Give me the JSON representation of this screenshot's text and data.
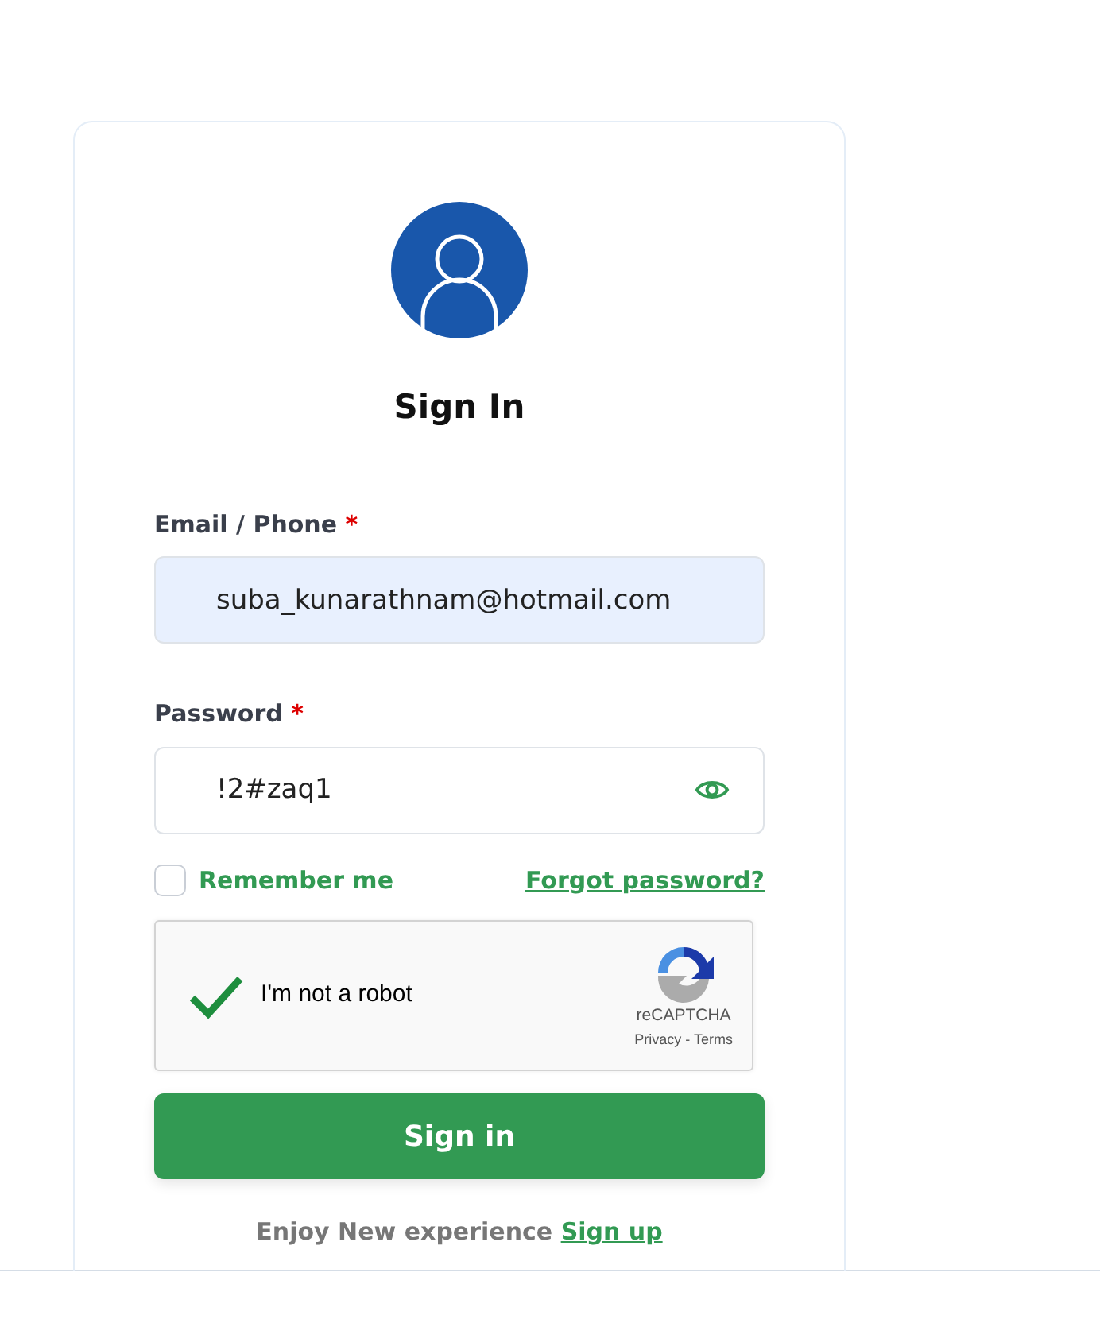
{
  "title": "Sign In",
  "fields": [
    {
      "kind": "text",
      "label": "Email / Phone",
      "required": true,
      "required_mark": "*",
      "value": "suba_kunarathnam@hotmail.com",
      "autofilled": true
    },
    {
      "kind": "password",
      "label": "Password",
      "required": true,
      "required_mark": "*",
      "value": "!2#zaq1",
      "autofilled": false
    }
  ],
  "remember": {
    "label": "Remember me",
    "checked": false
  },
  "forgot_link": "Forgot password?",
  "captcha": {
    "label": "I'm not a robot",
    "checked": true,
    "brand": "reCAPTCHA",
    "privacy": "Privacy",
    "separator": "-",
    "terms": "Terms"
  },
  "submit": "Sign in",
  "footer": {
    "text": "Enjoy New experience",
    "link": "Sign up"
  }
}
